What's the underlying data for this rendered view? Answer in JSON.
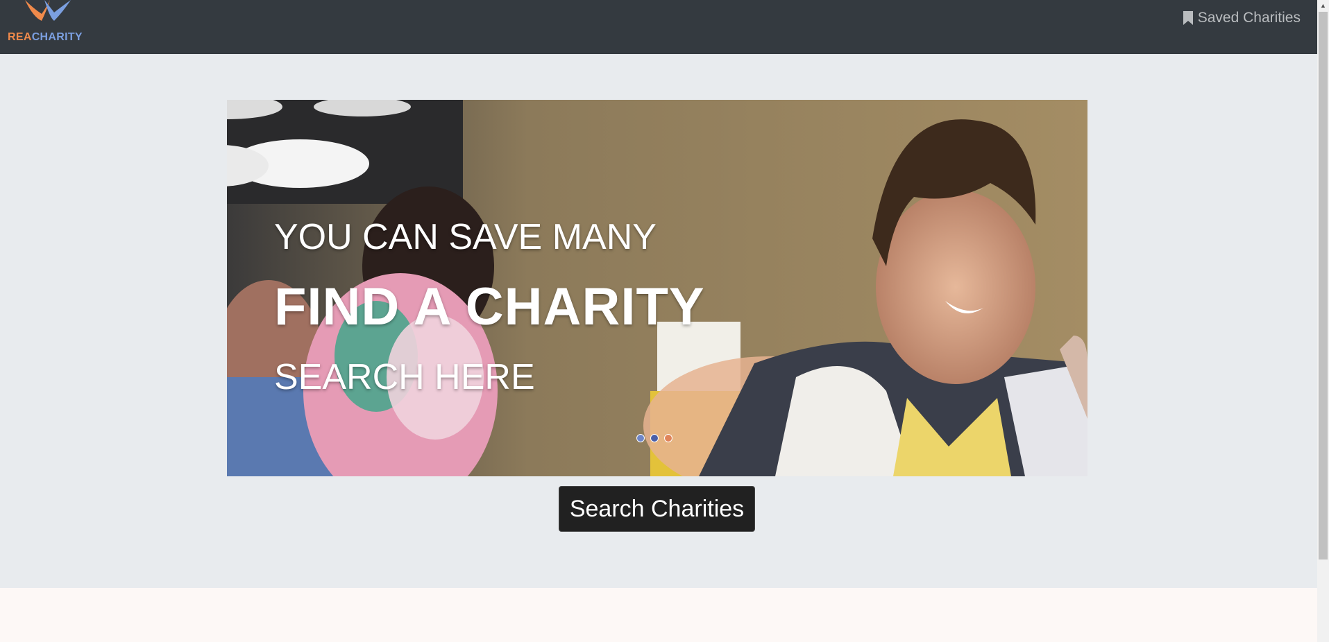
{
  "header": {
    "logo": {
      "part1": "REA",
      "part2": "CHARITY"
    },
    "saved_label": "Saved Charities",
    "saved_icon": "bookmark-icon"
  },
  "hero": {
    "slides": [
      {
        "line1": "YOU CAN SAVE MANY",
        "line2": "FIND A CHARITY",
        "line3": "SEARCH HERE"
      }
    ],
    "indicators": [
      {
        "color": "#6f86c7",
        "active": false
      },
      {
        "color": "#4a5fa8",
        "active": false
      },
      {
        "color": "#e0845a",
        "active": true
      }
    ],
    "search_button": "Search Charities"
  },
  "colors": {
    "navbar": "#343a40",
    "hero_bg": "#e8ebee",
    "footer_bg": "#fdf8f6",
    "logo_orange": "#f08a4b",
    "logo_blue": "#7b9fe0"
  }
}
